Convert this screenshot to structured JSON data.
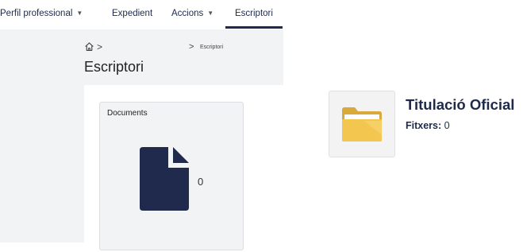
{
  "nav": {
    "items": [
      {
        "label": "Perfil professional",
        "dropdown": true
      },
      {
        "label": "Expedient",
        "dropdown": false
      },
      {
        "label": "Accions",
        "dropdown": true
      },
      {
        "label": "Escriptori",
        "dropdown": false,
        "active": true
      }
    ]
  },
  "breadcrumb": {
    "home_icon": "home-icon",
    "current": "Escriptori"
  },
  "page": {
    "title": "Escriptori"
  },
  "documents_card": {
    "title": "Documents",
    "icon": "document-icon",
    "count": "0"
  },
  "folder": {
    "name": "Titulació Oficial",
    "files_label": "Fitxers:",
    "files_count": "0",
    "icon": "folder-icon"
  },
  "colors": {
    "navy": "#1f2a4d",
    "panel_bg": "#f2f3f5",
    "folder_yellow": "#f3c64f"
  }
}
